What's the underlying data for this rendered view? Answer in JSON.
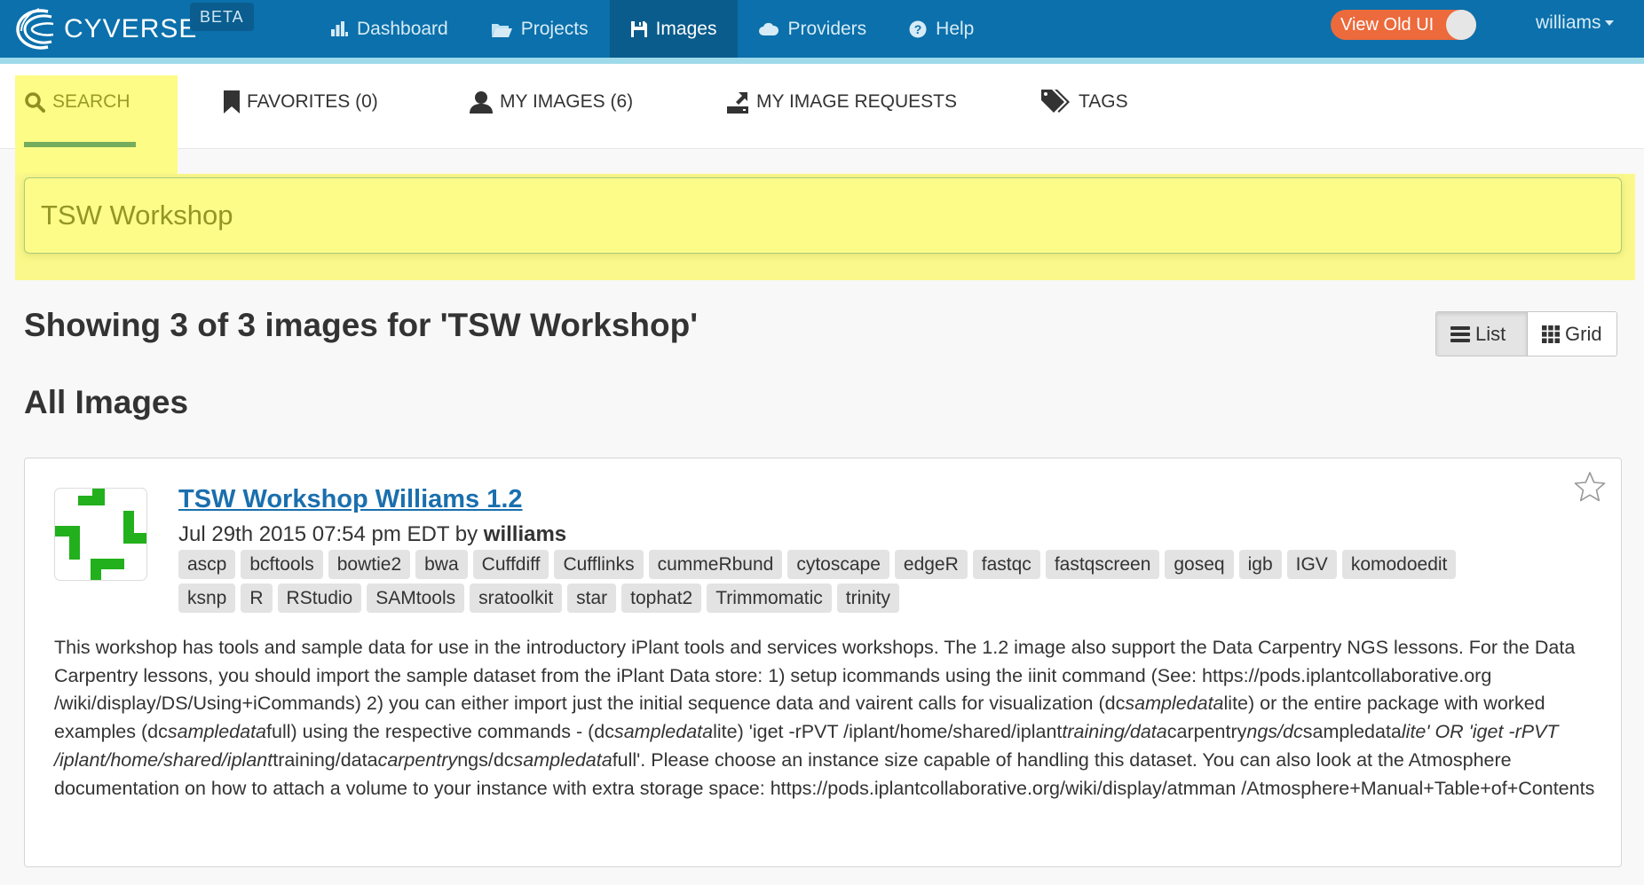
{
  "navbar": {
    "brand": "CYVERSE",
    "brand_tm": "™",
    "beta_label": "BETA",
    "items": [
      {
        "label": "Dashboard",
        "icon": "bar-chart-icon"
      },
      {
        "label": "Projects",
        "icon": "folder-open-icon"
      },
      {
        "label": "Images",
        "icon": "floppy-disk-icon",
        "active": true
      },
      {
        "label": "Providers",
        "icon": "cloud-icon"
      },
      {
        "label": "Help",
        "icon": "question-circle-icon"
      }
    ],
    "old_ui_toggle_label": "View Old UI",
    "username": "williams"
  },
  "subtabs": [
    {
      "label": "SEARCH",
      "icon": "search-icon",
      "active": true
    },
    {
      "label": "FAVORITES (0)",
      "icon": "bookmark-icon"
    },
    {
      "label": "MY IMAGES (6)",
      "icon": "user-icon"
    },
    {
      "label": "MY IMAGE REQUESTS",
      "icon": "export-icon"
    },
    {
      "label": "TAGS",
      "icon": "tags-icon"
    }
  ],
  "search": {
    "value": "TSW Workshop",
    "placeholder": ""
  },
  "results": {
    "heading": "Showing 3 of 3 images for 'TSW Workshop'",
    "section_title": "All Images",
    "view_toggle": {
      "list_label": "List",
      "grid_label": "Grid",
      "selected": "List"
    }
  },
  "image_card": {
    "title": "TSW Workshop Williams 1.2",
    "date": "Jul 29th 2015 07:54 pm EDT by",
    "author": "williams",
    "favorited": false,
    "tags": [
      "ascp",
      "bcftools",
      "bowtie2",
      "bwa",
      "Cuffdiff",
      "Cufflinks",
      "cummeRbund",
      "cytoscape",
      "edgeR",
      "fastqc",
      "fastqscreen",
      "goseq",
      "igb",
      "IGV",
      "komodoedit",
      "ksnp",
      "R",
      "RStudio",
      "SAMtools",
      "sratoolkit",
      "star",
      "tophat2",
      "Trimmomatic",
      "trinity"
    ],
    "description_segments": [
      {
        "t": "This workshop has tools and sample data for use in the introductory iPlant tools and services workshops. The 1.2 image also support the Data Carpentry NGS lessons. For the Data Carpentry lessons, you should import the sample dataset from the iPlant Data store: 1) setup icommands using the iinit command (See: https://pods.iplantcollaborative.org /wiki/display/DS/Using+iCommands) 2) you can either import just the initial sequence data and vairent calls for visualization (dc",
        "i": false
      },
      {
        "t": "sampledata",
        "i": true
      },
      {
        "t": "lite) or the entire package with worked examples (dc",
        "i": false
      },
      {
        "t": "sampledata",
        "i": true
      },
      {
        "t": "full) using the respective commands - (dc",
        "i": false
      },
      {
        "t": "sampledata",
        "i": true
      },
      {
        "t": "lite) 'iget -rPVT /iplant/home/shared/iplant",
        "i": false
      },
      {
        "t": "training/data",
        "i": true
      },
      {
        "t": "carpentry",
        "i": false
      },
      {
        "t": "ngs/dc",
        "i": true
      },
      {
        "t": "sampledata",
        "i": false
      },
      {
        "t": "lite' OR 'iget -rPVT /iplant/home/shared/iplant",
        "i": true
      },
      {
        "t": "training/data",
        "i": false
      },
      {
        "t": "carpentry",
        "i": true
      },
      {
        "t": "ngs/dc",
        "i": false
      },
      {
        "t": "sampledata",
        "i": true
      },
      {
        "t": "full'. Please choose an instance size capable of handling this dataset. You can also look at the Atmosphere documentation on how to attach a volume to your instance with extra storage space: https://pods.iplantcollaborative.org/wiki/display/atmman /Atmosphere+Manual+Table+of+Contents",
        "i": false
      }
    ]
  },
  "colors": {
    "navbar": "#0b70ab",
    "navbar_active": "#0a5c8c",
    "nav_strip": "#9fdaea",
    "toggle": "#ec6a3c",
    "highlight": "#fdfc86",
    "underline": "#76ad5d",
    "link": "#1a6fae",
    "thumb_green": "#22b01c"
  }
}
